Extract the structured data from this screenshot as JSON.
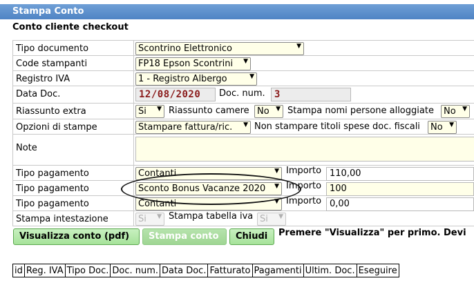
{
  "window": {
    "title": "Stampa Conto",
    "subtitle": "Conto cliente checkout"
  },
  "form": {
    "tipo_documento": {
      "label": "Tipo documento",
      "value": "Scontrino Elettronico"
    },
    "code_stampanti": {
      "label": "Code stampanti",
      "value": "FP18 Epson Scontrini"
    },
    "registro_iva": {
      "label": "Registro IVA",
      "value": "1 - Registro Albergo"
    },
    "data_doc": {
      "label": "Data Doc.",
      "value": "12/08/2020",
      "doc_num_label": "Doc. num.",
      "doc_num_value": "3"
    },
    "riassunto_extra": {
      "label": "Riassunto extra",
      "value": "Si",
      "camere_label": "Riassunto camere",
      "camere_value": "No",
      "nomi_label": "Stampa nomi persone alloggiate",
      "nomi_value": "No"
    },
    "opzioni_stampe": {
      "label": "Opzioni di stampe",
      "value": "Stampare fattura/ric.",
      "titoli_label": "Non stampare titoli spese doc. fiscali",
      "titoli_value": "No"
    },
    "note": {
      "label": "Note",
      "value": ""
    },
    "pagamenti": [
      {
        "label": "Tipo pagamento",
        "value": "Contanti",
        "importo_label": "Importo",
        "importo_value": "110,00"
      },
      {
        "label": "Tipo pagamento",
        "value": "Sconto Bonus Vacanze 2020",
        "importo_label": "Importo",
        "importo_value": "100"
      },
      {
        "label": "Tipo pagamento",
        "value": "Contanti",
        "importo_label": "Importo",
        "importo_value": "0,00"
      }
    ],
    "intestazione": {
      "label": "Stampa intestazione",
      "value": "Si",
      "tabella_label": "Stampa tabella iva",
      "tabella_value": "Si"
    }
  },
  "buttons": {
    "visualizza": "Visualizza conto (pdf)",
    "stampa": "Stampa conto",
    "chiudi": "Chiudi"
  },
  "hint": "Premere \"Visualizza\" per primo. Devi",
  "table": {
    "headers": [
      "id",
      "Reg. IVA",
      "Tipo Doc.",
      "Doc. num.",
      "Data Doc.",
      "Fatturato",
      "Pagamenti",
      "Ultim. Doc.",
      "Eseguire"
    ]
  },
  "colors": {
    "titlebar": "#4f84c4",
    "button_green": "#a6e29a",
    "input_yellow": "#ffffe8",
    "date_text": "#8a1a1a"
  }
}
